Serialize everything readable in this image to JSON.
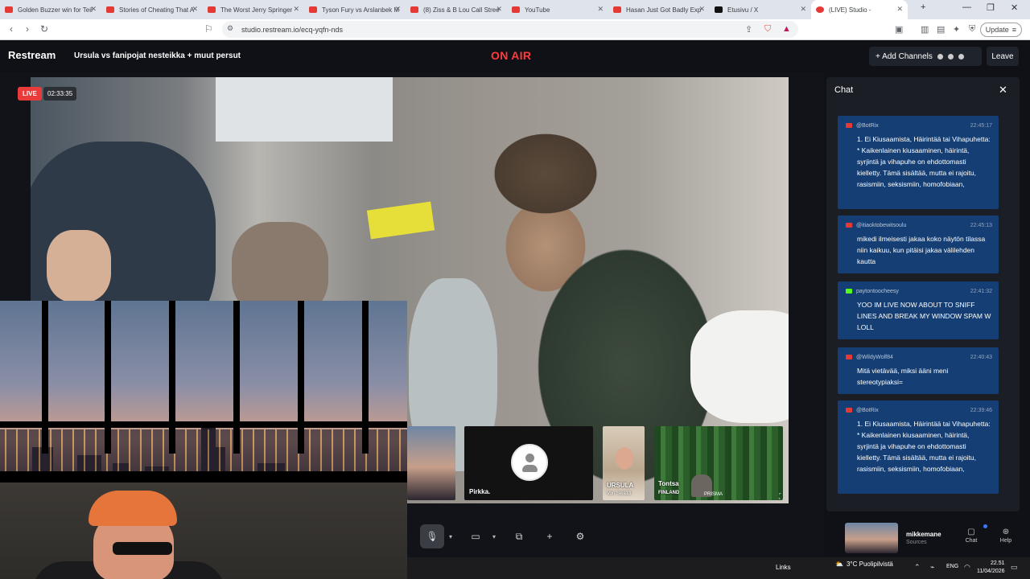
{
  "browser": {
    "tabs": [
      {
        "title": "Golden Buzzer win for Teil",
        "icon": "youtube-icon"
      },
      {
        "title": "Stories of Cheating That A",
        "icon": "youtube-icon"
      },
      {
        "title": "The Worst Jerry Springer",
        "icon": "youtube-icon"
      },
      {
        "title": "Tyson Fury vs Arslanbek M",
        "icon": "youtube-icon"
      },
      {
        "title": "(8) Ziss & B Lou Call Stree",
        "icon": "youtube-icon"
      },
      {
        "title": "YouTube",
        "icon": "youtube-icon"
      },
      {
        "title": "Hasan Just Got Badly Exp",
        "icon": "youtube-icon"
      },
      {
        "title": "Etusivu / X",
        "icon": "x-icon"
      },
      {
        "title": "(LIVE) Studio -",
        "icon": "restream-icon",
        "active": true
      }
    ],
    "url": "studio.restream.io/ecq-yqfn-nds",
    "update_label": "Update"
  },
  "header": {
    "logo": "Restream",
    "stream_title": "Ursula vs fanipojat nesteikka + muut persut",
    "on_air": "ON AIR",
    "add_channels": "+ Add Channels",
    "leave": "Leave"
  },
  "stage": {
    "live_badge": "LIVE",
    "timer": "02:33:35"
  },
  "guests": [
    {
      "name": "Pirkka.",
      "sub": ""
    },
    {
      "name": "URSULA",
      "sub": "Von Swa13"
    },
    {
      "name": "Tontsa",
      "sub": "FINLAND",
      "logo": "PRISMA"
    }
  ],
  "controls": [
    "mic-icon",
    "camera-icon",
    "share-screen-icon",
    "add-icon",
    "settings-icon"
  ],
  "chat": {
    "title": "Chat",
    "messages": [
      {
        "platform": "youtube",
        "user": "@BotRix",
        "time": "22:45:17",
        "text": "1. Ei Kiusaamista, Häirintää tai Vihapuhetta: * Kaikenlainen kiusaaminen, häirintä, syrjintä ja vihapuhe on ehdottomasti kielletty. Tämä sisältää, mutta ei rajoitu, rasismiin, seksismiin, homofobiaan,"
      },
      {
        "platform": "youtube",
        "user": "@itiaoktobewitsoulu",
        "time": "22:45:13",
        "text": "mikedi ilmeisesti jakaa koko näytön tilassa niin kaikuu, kun pitäisi jakaa välilehden kautta"
      },
      {
        "platform": "kick",
        "user": "paytontoocheesy",
        "time": "22:41:32",
        "text": "YOO IM LIVE NOW ABOUT TO SNIFF LINES AND BREAK MY WINDOW SPAM W LOLL"
      },
      {
        "platform": "youtube",
        "user": "@WildyWolf84",
        "time": "22:40:43",
        "text": "Mitä vietävää, miksi ääni meni stereotypiaksi="
      },
      {
        "platform": "youtube",
        "user": "@BotRix",
        "time": "22:39:46",
        "text": "1. Ei Kiusaamista, Häirintää tai Vihapuhetta: * Kaikenlainen kiusaaminen, häirintä, syrjintä ja vihapuhe on ehdottomasti kielletty. Tämä sisältää, mutta ei rajoitu, rasismiin, seksismiin, homofobiaan,"
      }
    ]
  },
  "sources": {
    "name": "mikkemane",
    "label": "Sources",
    "chat_label": "Chat",
    "help_label": "Help"
  },
  "taskbar": {
    "links": "Links",
    "weather": "3°C  Puolipilvistä",
    "lang": "ENG",
    "time": "22.51",
    "date": "11/04/2026"
  }
}
